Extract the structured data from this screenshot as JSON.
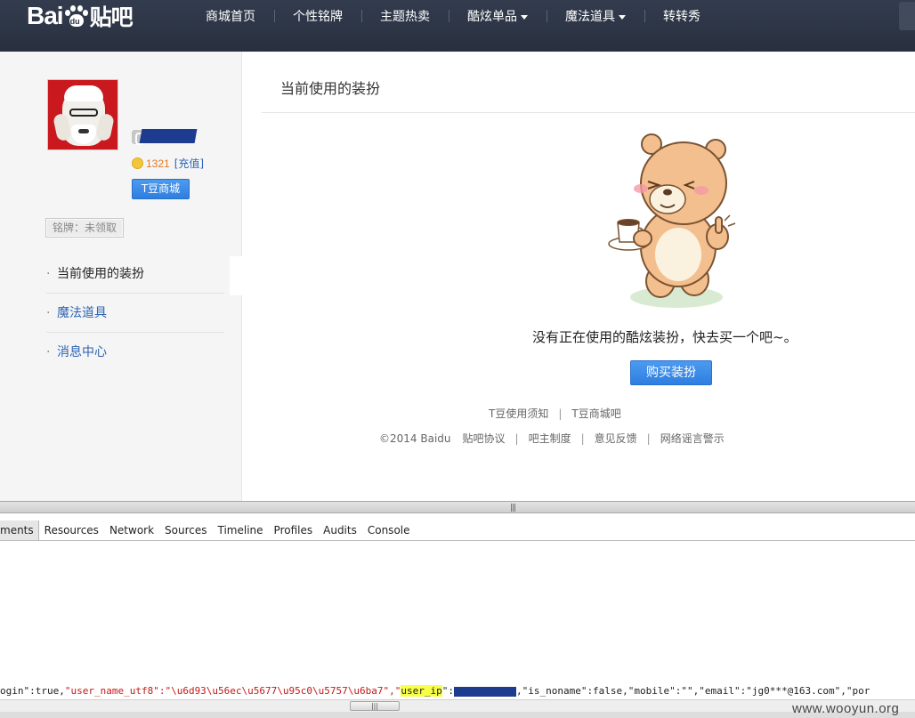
{
  "header": {
    "logo_text_bai": "Bai",
    "logo_text_du": "du",
    "logo_text_tieba": "贴吧",
    "nav": [
      {
        "label": "商城首页",
        "dropdown": false
      },
      {
        "label": "个性铭牌",
        "dropdown": false
      },
      {
        "label": "主题热卖",
        "dropdown": false
      },
      {
        "label": "酷炫单品",
        "dropdown": true
      },
      {
        "label": "魔法道具",
        "dropdown": true
      },
      {
        "label": "转转秀",
        "dropdown": false
      }
    ]
  },
  "user": {
    "coin_count": "1321",
    "recharge_label": "[充值]",
    "shop_button": "T豆商城",
    "badge_status": "铭牌：未领取"
  },
  "sidebar_menu": [
    {
      "label": "当前使用的装扮",
      "active": true
    },
    {
      "label": "魔法道具",
      "active": false
    },
    {
      "label": "消息中心",
      "active": false
    }
  ],
  "content": {
    "title": "当前使用的装扮",
    "empty_message": "没有正在使用的酷炫装扮，快去买一个吧~。",
    "buy_button": "购买装扮"
  },
  "footer": {
    "row1": [
      "T豆使用须知",
      "T豆商城吧"
    ],
    "copyright": "©2014 Baidu",
    "row2": [
      "贴吧协议",
      "吧主制度",
      "意见反馈",
      "网络谣言警示"
    ]
  },
  "devtools": {
    "tabs": [
      "ments",
      "Resources",
      "Network",
      "Sources",
      "Timeline",
      "Profiles",
      "Audits",
      "Console"
    ],
    "console": {
      "seg1": "ogin\":true,",
      "seg2_key": "\"user_name_utf8\"",
      "seg2_val": ":\"\\u6d93\\u56ec\\u5677\\u95c0\\u5757\\u6ba7\",\"",
      "seg3_key": "user_ip",
      "seg3_tail": "\":",
      "seg4": ",\"is_noname\":false,\"mobile\":\"\",\"email\":\"jg0***@163.com\",\"por"
    }
  },
  "watermark": "www.wooyun.org",
  "colors": {
    "header_bg": "#2d3748",
    "link_blue": "#2d64b3",
    "button_blue": "#3a8ae8",
    "coin_orange": "#e47a1f",
    "highlight_yellow": "#f8ff47"
  },
  "icons": {
    "level": "level-icon",
    "coin": "coin-icon",
    "caret": "chevron-down-icon",
    "bear": "bear-mascot-illustration"
  }
}
